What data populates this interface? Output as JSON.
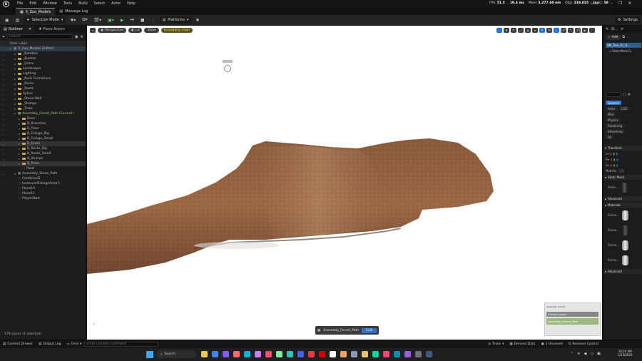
{
  "titlebar": {
    "menu": [
      "File",
      "Edit",
      "Window",
      "Tools",
      "Build",
      "Select",
      "Actor",
      "Help"
    ],
    "stats": [
      {
        "label": "FPS:",
        "value": "51.5"
      },
      {
        "label": "",
        "value": "19.4 ms"
      },
      {
        "label": "Mem:",
        "value": "5,277.60 mb"
      },
      {
        "label": "Objs:",
        "value": "319,835"
      },
      {
        "label": "Static:",
        "value": "58"
      }
    ],
    "user": "Lobo"
  },
  "tabs": {
    "level_tab": "X_Zoo_Models",
    "message_log": "Message Log"
  },
  "toolbar": {
    "mode": "Selection Mode",
    "platforms": "Platforms",
    "settings": "Settings"
  },
  "outliner": {
    "tab": "Outliner",
    "place_actors": "Place Actors",
    "search_placeholder": "Search",
    "column": "Item Label",
    "items": [
      {
        "label": "X_Zoo_Models (Editor)",
        "depth": 0,
        "type": "level",
        "style": "hl"
      },
      {
        "label": "_Bamboo",
        "depth": 1,
        "type": "folder"
      },
      {
        "label": "_Bushes",
        "depth": 1,
        "type": "folder"
      },
      {
        "label": "_Grass",
        "depth": 1,
        "type": "folder"
      },
      {
        "label": "Landscaper",
        "depth": 1,
        "type": "folder"
      },
      {
        "label": "Lighting",
        "depth": 1,
        "type": "folder"
      },
      {
        "label": "_Rock Formations",
        "depth": 1,
        "type": "folder"
      },
      {
        "label": "_Rocks",
        "depth": 1,
        "type": "folder"
      },
      {
        "label": "_Roots",
        "depth": 1,
        "type": "folder"
      },
      {
        "label": "Spline",
        "depth": 1,
        "type": "folder"
      },
      {
        "label": "_Stone Wall",
        "depth": 1,
        "type": "folder"
      },
      {
        "label": "_Stumps",
        "depth": 1,
        "type": "folder"
      },
      {
        "label": "_Trees",
        "depth": 1,
        "type": "folder"
      },
      {
        "label": "Assembly_Forest_Path (Current)",
        "depth": 1,
        "type": "level-current",
        "style": "green"
      },
      {
        "label": "Base",
        "depth": 2,
        "type": "folder"
      },
      {
        "label": "B_Branches",
        "depth": 2,
        "type": "folder"
      },
      {
        "label": "B_Floor",
        "depth": 2,
        "type": "folder"
      },
      {
        "label": "B_Foliage_Big",
        "depth": 2,
        "type": "folder"
      },
      {
        "label": "B_Foliage_Small",
        "depth": 2,
        "type": "folder"
      },
      {
        "label": "B_Grass",
        "depth": 2,
        "type": "folder",
        "style": "sel"
      },
      {
        "label": "B_Rocks_Big",
        "depth": 2,
        "type": "folder"
      },
      {
        "label": "B_Rocks_Small",
        "depth": 2,
        "type": "folder"
      },
      {
        "label": "B_Stumps",
        "depth": 2,
        "type": "folder"
      },
      {
        "label": "B_Trees",
        "depth": 2,
        "type": "folder",
        "style": "sel"
      },
      {
        "label": "Pivot",
        "depth": 2,
        "type": "actor"
      },
      {
        "label": "Assembly_Stone_Path",
        "depth": 1,
        "type": "level"
      },
      {
        "label": "Combined2",
        "depth": 1,
        "type": "actor"
      },
      {
        "label": "InstancedFoliageActor1",
        "depth": 1,
        "type": "actor"
      },
      {
        "label": "Plane10",
        "depth": 1,
        "type": "actor"
      },
      {
        "label": "Plane11",
        "depth": 1,
        "type": "actor"
      },
      {
        "label": "PlayerStart",
        "depth": 1,
        "type": "actor"
      }
    ],
    "count": "179 actors (1 selected)"
  },
  "viewport": {
    "view_mode": "Perspective",
    "lit": "Lit",
    "show": "Show",
    "scalability": "Scalability: High",
    "level_edit_label": "Assembly_Forest_Path",
    "exit_label": "Exit",
    "toast_title": "Current Level:",
    "toast_sub": "Assembly_Forest_Path"
  },
  "details": {
    "tab": "D...",
    "add_label": "Add",
    "selected_component": "SM_Tree_01_D...",
    "child_component": "StaticMeshCo",
    "categories": [
      "General",
      "Actor",
      "LOD",
      "Misc",
      "Physics",
      "Rendering",
      "Streaming",
      "All"
    ],
    "sections": {
      "transform": "Transform",
      "mobility": "Mobility",
      "static_mesh": "Static Mesh",
      "static_label": "Static...",
      "advanced": "Advanced",
      "materials": "Materials",
      "element": "Eleme..."
    }
  },
  "statusbar": {
    "content_drawer": "Content Drawer",
    "output_log": "Output Log",
    "cmd": "Cmd",
    "cmd_placeholder": "Enter Console Command",
    "trace": "Trace",
    "derived_data": "Derived Data",
    "unsaved": "1 Unsaved",
    "revision": "Revision Control"
  },
  "taskbar": {
    "search": "Search",
    "time": "10:24 AM",
    "date": "1/23/2025"
  },
  "colors": {
    "accent_blue": "#2d73d0",
    "play_green": "#5fd35f",
    "folder": "#c8a244",
    "current_level": "#9ad66a"
  }
}
